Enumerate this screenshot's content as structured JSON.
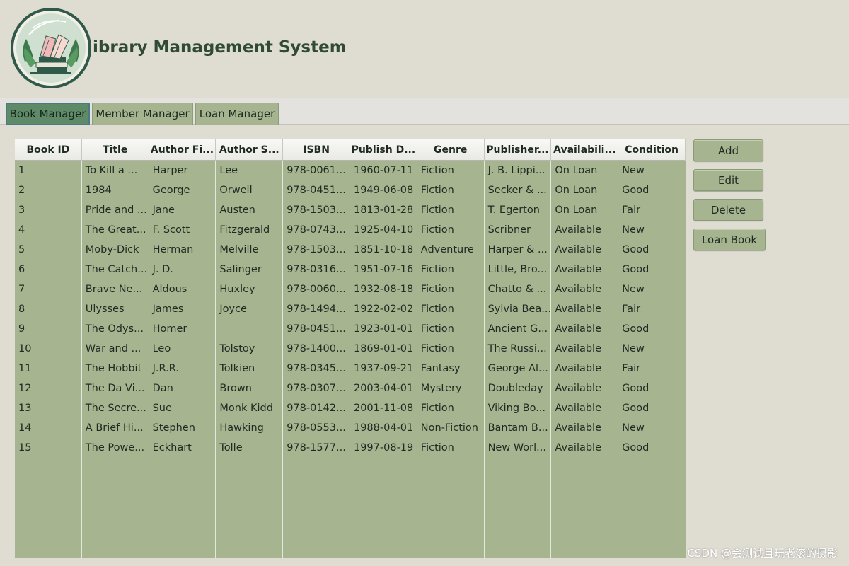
{
  "app": {
    "title": "ibrary Management System"
  },
  "tabs": [
    {
      "label": "Book Manager",
      "active": true
    },
    {
      "label": "Member Manager",
      "active": false
    },
    {
      "label": "Loan Manager",
      "active": false
    }
  ],
  "table": {
    "columns": [
      "Book ID",
      "Title",
      "Author Fi...",
      "Author S...",
      "ISBN",
      "Publish D...",
      "Genre",
      "Publisher...",
      "Availabili...",
      "Condition"
    ],
    "rows": [
      [
        "1",
        "To Kill a ...",
        "Harper",
        "Lee",
        "978-0061...",
        "1960-07-11",
        "Fiction",
        "J. B. Lippi...",
        "On Loan",
        "New"
      ],
      [
        "2",
        "1984",
        "George",
        "Orwell",
        "978-0451...",
        "1949-06-08",
        "Fiction",
        "Secker & ...",
        "On Loan",
        "Good"
      ],
      [
        "3",
        "Pride and ...",
        "Jane",
        "Austen",
        "978-1503...",
        "1813-01-28",
        "Fiction",
        "T. Egerton",
        "On Loan",
        "Fair"
      ],
      [
        "4",
        "The Great...",
        "F. Scott",
        "Fitzgerald",
        "978-0743...",
        "1925-04-10",
        "Fiction",
        "Scribner",
        "Available",
        "New"
      ],
      [
        "5",
        "Moby-Dick",
        "Herman",
        "Melville",
        "978-1503...",
        "1851-10-18",
        "Adventure",
        "Harper & ...",
        "Available",
        "Good"
      ],
      [
        "6",
        "The Catch...",
        "J. D.",
        "Salinger",
        "978-0316...",
        "1951-07-16",
        "Fiction",
        "Little, Bro...",
        "Available",
        "Good"
      ],
      [
        "7",
        "Brave Ne...",
        "Aldous",
        "Huxley",
        "978-0060...",
        "1932-08-18",
        "Fiction",
        "Chatto & ...",
        "Available",
        "New"
      ],
      [
        "8",
        "Ulysses",
        "James",
        "Joyce",
        "978-1494...",
        "1922-02-02",
        "Fiction",
        "Sylvia Bea...",
        "Available",
        "Fair"
      ],
      [
        "9",
        "The Odys...",
        "Homer",
        "",
        "978-0451...",
        "1923-01-01",
        "Fiction",
        "Ancient G...",
        "Available",
        "Good"
      ],
      [
        "10",
        "War and ...",
        "Leo",
        "Tolstoy",
        "978-1400...",
        "1869-01-01",
        "Fiction",
        "The Russi...",
        "Available",
        "New"
      ],
      [
        "11",
        "The Hobbit",
        "J.R.R.",
        "Tolkien",
        "978-0345...",
        "1937-09-21",
        "Fantasy",
        "George Al...",
        "Available",
        "Fair"
      ],
      [
        "12",
        "The Da Vi...",
        "Dan",
        "Brown",
        "978-0307...",
        "2003-04-01",
        "Mystery",
        "Doubleday",
        "Available",
        "Good"
      ],
      [
        "13",
        "The Secre...",
        "Sue",
        "Monk Kidd",
        "978-0142...",
        "2001-11-08",
        "Fiction",
        "Viking Bo...",
        "Available",
        "Good"
      ],
      [
        "14",
        "A Brief Hi...",
        "Stephen",
        "Hawking",
        "978-0553...",
        "1988-04-01",
        "Non-Fiction",
        "Bantam B...",
        "Available",
        "New"
      ],
      [
        "15",
        "The Powe...",
        "Eckhart",
        "Tolle",
        "978-1577...",
        "1997-08-19",
        "Fiction",
        "New Worl...",
        "Available",
        "Good"
      ]
    ]
  },
  "actions": {
    "add": "Add",
    "edit": "Edit",
    "delete": "Delete",
    "loan_book": "Loan Book"
  },
  "watermark": "CSDN @会测试且玩老滚的摄影",
  "colors": {
    "background": "#dfdcd2",
    "accent_green": "#a6b590",
    "active_tab": "#5f8a68",
    "title_text": "#2f4a35"
  },
  "icons": {
    "logo": "books-logo-icon"
  }
}
